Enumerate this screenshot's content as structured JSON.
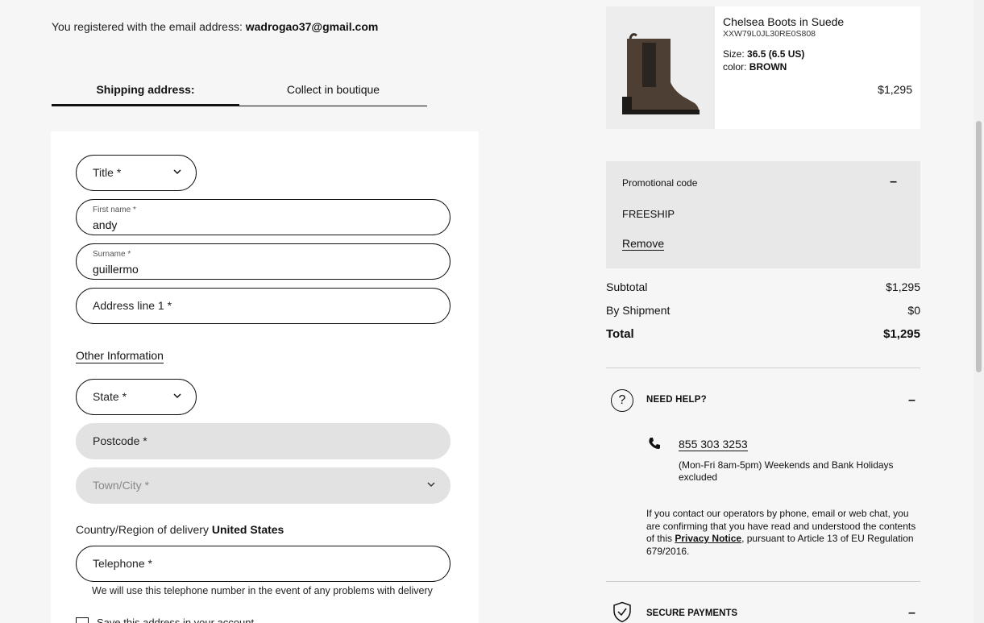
{
  "header": {
    "registered_prefix": "You registered with the email address:",
    "email": "wadrogao37@gmail.com"
  },
  "tabs": {
    "shipping": "Shipping address:",
    "boutique": "Collect in boutique"
  },
  "form": {
    "title_placeholder": "Title *",
    "first_name_label": "First name *",
    "first_name_value": "andy",
    "surname_label": "Surname *",
    "surname_value": "guillermo",
    "address1_placeholder": "Address line 1 *",
    "other_info": "Other Information",
    "state_placeholder": "State *",
    "postcode_placeholder": "Postcode *",
    "town_placeholder": "Town/City *",
    "country_prefix": "Country/Region of delivery",
    "country_value": "United States",
    "telephone_placeholder": "Telephone *",
    "telephone_hint": "We will use this telephone number in the event of any problems with delivery",
    "save_address": "Save this address in your account"
  },
  "product": {
    "name": "Chelsea Boots in Suede",
    "sku": "XXW79L0JL30RE0S808",
    "size_label": "Size:",
    "size_value": "36.5 (6.5 US)",
    "color_label": "color:",
    "color_value": "BROWN",
    "price": "$1,295"
  },
  "promo": {
    "title": "Promotional code",
    "toggle": "–",
    "code": "FREESHIP",
    "remove": "Remove"
  },
  "totals": {
    "subtotal_label": "Subtotal",
    "subtotal_value": "$1,295",
    "shipment_label": "By Shipment",
    "shipment_value": "$0",
    "total_label": "Total",
    "total_value": "$1,295"
  },
  "help": {
    "title": "NEED HELP?",
    "toggle": "–",
    "phone": "855 303 3253",
    "hours": "(Mon-Fri 8am-5pm) Weekends and Bank Holidays excluded",
    "consent_before": "If you contact our operators by phone, email or web chat, you are confirming that you have read and understood the contents of this ",
    "privacy_link": "Privacy Notice",
    "consent_after": ", pursuant to Article 13 of EU Regulation 679/2016."
  },
  "secure": {
    "title": "SECURE PAYMENTS",
    "toggle": "–"
  },
  "icons": {
    "chevron": "chevron-down-icon",
    "question": "question-icon",
    "phone": "phone-icon",
    "shield": "shield-check-icon"
  },
  "colors": {
    "text": "#111111",
    "page_bg": "#f6f6f6",
    "panel_bg": "#e8e8e8",
    "disabled_field": "#e2e2e2"
  }
}
